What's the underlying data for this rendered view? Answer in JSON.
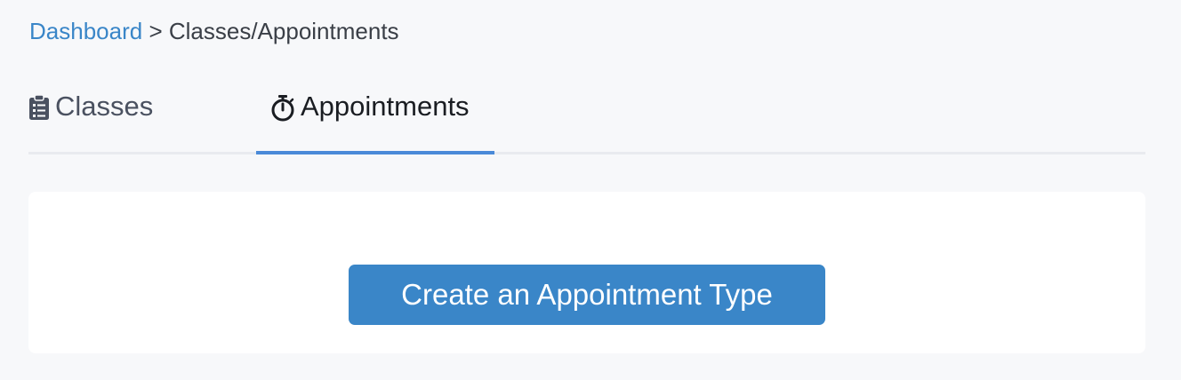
{
  "breadcrumb": {
    "link": "Dashboard",
    "separator": ">",
    "current": "Classes/Appointments"
  },
  "tabs": [
    {
      "label": "Classes",
      "icon": "clipboard-icon",
      "active": false
    },
    {
      "label": "Appointments",
      "icon": "stopwatch-icon",
      "active": true
    }
  ],
  "card": {
    "cta_label": "Create an Appointment Type"
  },
  "colors": {
    "link": "#3a86c8",
    "active_tab_underline": "#4a8ad8",
    "button_bg": "#3a86c8",
    "page_bg": "#f7f8fa"
  }
}
